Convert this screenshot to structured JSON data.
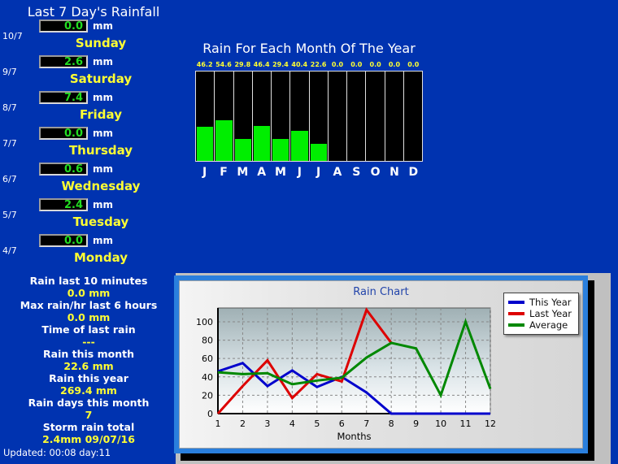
{
  "left_panel": {
    "title": "Last 7 Day's Rainfall",
    "unit": "mm",
    "days": [
      {
        "date": "10/7",
        "value": "0.0",
        "unit": "mm",
        "name": "Sunday"
      },
      {
        "date": "9/7",
        "value": "2.6",
        "unit": "mm",
        "name": "Saturday"
      },
      {
        "date": "8/7",
        "value": "7.4",
        "unit": "mm",
        "name": "Friday"
      },
      {
        "date": "7/7",
        "value": "0.0",
        "unit": "mm",
        "name": "Thursday"
      },
      {
        "date": "6/7",
        "value": "0.6",
        "unit": "mm",
        "name": "Wednesday"
      },
      {
        "date": "5/7",
        "value": "2.4",
        "unit": "mm",
        "name": "Tuesday"
      },
      {
        "date": "4/7",
        "value": "0.0",
        "unit": "mm",
        "name": "Monday"
      }
    ],
    "stats": [
      {
        "label": "Rain last 10 minutes",
        "value": "0.0 mm"
      },
      {
        "label": "Max rain/hr last 6 hours",
        "value": "0.0 mm"
      },
      {
        "label": "Time of last rain",
        "value": "---"
      },
      {
        "label": "Rain this month",
        "value": "22.6 mm"
      },
      {
        "label": "Rain this year",
        "value": "269.4 mm"
      },
      {
        "label": "Rain days this month",
        "value": "7"
      },
      {
        "label": "Storm rain total",
        "value": "2.4mm 09/07/16"
      }
    ],
    "updated": "Updated: 00:08 day:11"
  },
  "monthly": {
    "title": "Rain For Each Month Of The Year"
  },
  "rain_chart": {
    "title": "Rain Chart",
    "xlabel": "Months",
    "legend": [
      {
        "name": "This Year",
        "color": "#0000cc"
      },
      {
        "name": "Last Year",
        "color": "#dd0000"
      },
      {
        "name": "Average",
        "color": "#008800"
      }
    ]
  },
  "chart_data": [
    {
      "type": "bar",
      "title": "Rain For Each Month Of The Year",
      "categories": [
        "J",
        "F",
        "M",
        "A",
        "M",
        "J",
        "J",
        "A",
        "S",
        "O",
        "N",
        "D"
      ],
      "values": [
        46.2,
        54.6,
        29.8,
        46.4,
        29.4,
        40.4,
        22.6,
        0.0,
        0.0,
        0.0,
        0.0,
        0.0
      ],
      "value_labels": [
        "46.2",
        "54.6",
        "29.8",
        "46.4",
        "29.4",
        "40.4",
        "22.6",
        "0.0",
        "0.0",
        "0.0",
        "0.0",
        "0.0"
      ],
      "xlabel": "",
      "ylabel": "",
      "ylim": [
        0,
        120
      ],
      "grid": false,
      "bar_color": "#00ee00",
      "background": "#000000"
    },
    {
      "type": "line",
      "title": "Rain Chart",
      "xlabel": "Months",
      "ylabel": "",
      "x": [
        1,
        2,
        3,
        4,
        5,
        6,
        7,
        8,
        9,
        10,
        11,
        12
      ],
      "xticklabels": [
        "1",
        "2",
        "3",
        "4",
        "5",
        "6",
        "7",
        "8",
        "9",
        "10",
        "11",
        "12"
      ],
      "yticks": [
        0,
        20,
        40,
        60,
        80,
        100
      ],
      "ylim": [
        0,
        115
      ],
      "xlim": [
        1,
        12
      ],
      "grid": true,
      "legend_position": "outside-top-right",
      "series": [
        {
          "name": "This Year",
          "color": "#0000cc",
          "values": [
            46,
            55,
            30,
            47,
            29,
            40,
            23,
            0,
            0,
            0,
            0,
            0
          ]
        },
        {
          "name": "Last Year",
          "color": "#dd0000",
          "values": [
            0,
            30,
            58,
            17,
            43,
            35,
            113,
            77,
            null,
            null,
            null,
            null
          ]
        },
        {
          "name": "Average",
          "color": "#008800",
          "values": [
            45,
            43,
            44,
            32,
            36,
            39,
            61,
            77,
            71,
            20,
            100,
            27
          ]
        }
      ]
    }
  ]
}
